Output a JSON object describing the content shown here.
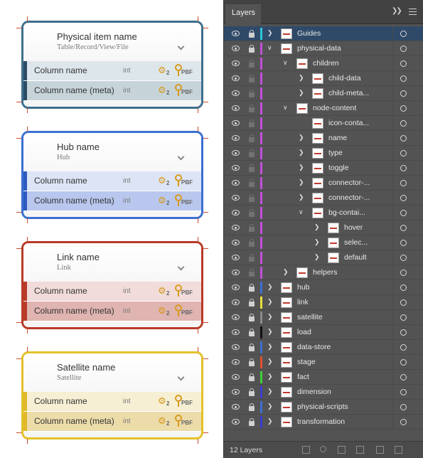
{
  "canvas": {
    "nodes": [
      {
        "title": "Physical item name",
        "subtitle": "Table/Record/View/File",
        "color": "#3f6f8c",
        "row_bar": "#2a4d66",
        "row1_bg": "#dde6ea",
        "row2_bg": "#c6d4da",
        "rows": [
          {
            "name": "Column name",
            "type": "int",
            "gear_sub": "2",
            "key_label": "PBF"
          },
          {
            "name": "Column name (meta)",
            "type": "int",
            "gear_sub": "2",
            "key_label": "PBF"
          }
        ]
      },
      {
        "title": "Hub name",
        "subtitle": "Hub",
        "color": "#3b6fd1",
        "row_bar": "#2f5bc0",
        "row1_bg": "#dde4f5",
        "row2_bg": "#b9c7ee",
        "rows": [
          {
            "name": "Column name",
            "type": "int",
            "gear_sub": "2",
            "key_label": "PBF"
          },
          {
            "name": "Column name (meta)",
            "type": "int",
            "gear_sub": "2",
            "key_label": "PBF"
          }
        ]
      },
      {
        "title": "Link name",
        "subtitle": "Link",
        "color": "#b83a28",
        "row_bar": "#b83a28",
        "row1_bg": "#f1dcdb",
        "row2_bg": "#dfb4b1",
        "rows": [
          {
            "name": "Column name",
            "type": "int",
            "gear_sub": "2",
            "key_label": "PBF"
          },
          {
            "name": "Column name (meta)",
            "type": "int",
            "gear_sub": "2",
            "key_label": "PBF"
          }
        ]
      },
      {
        "title": "Satellite name",
        "subtitle": "Satellite",
        "color": "#e3c12a",
        "row_bar": "#e0b829",
        "row1_bg": "#f6efd4",
        "row2_bg": "#ecdcaa",
        "rows": [
          {
            "name": "Column name",
            "type": "int",
            "gear_sub": "2",
            "key_label": "PBF"
          },
          {
            "name": "Column name (meta)",
            "type": "int",
            "gear_sub": "2",
            "key_label": "PBF"
          }
        ]
      }
    ]
  },
  "panel": {
    "tab_label": "Layers",
    "status_count": "12 Layers",
    "layers": [
      {
        "name": "Guides",
        "depth": 0,
        "twirl": "closed",
        "color": "#2ec4d6",
        "locked": true,
        "selected": true,
        "thumb": true
      },
      {
        "name": "physical-data",
        "depth": 0,
        "twirl": "open",
        "color": "#c14fd9",
        "locked": true,
        "selected": false,
        "thumb": true
      },
      {
        "name": "children",
        "depth": 1,
        "twirl": "open",
        "color": "#c14fd9",
        "locked": false,
        "selected": false,
        "thumb": true
      },
      {
        "name": "child-data",
        "depth": 2,
        "twirl": "closed",
        "color": "#c14fd9",
        "locked": false,
        "selected": false,
        "thumb": true
      },
      {
        "name": "child-meta...",
        "depth": 2,
        "twirl": "closed",
        "color": "#c14fd9",
        "locked": false,
        "selected": false,
        "thumb": true
      },
      {
        "name": "node-content",
        "depth": 1,
        "twirl": "open",
        "color": "#c14fd9",
        "locked": false,
        "selected": false,
        "thumb": true
      },
      {
        "name": "icon-conta...",
        "depth": 2,
        "twirl": "none",
        "color": "#c14fd9",
        "locked": false,
        "selected": false,
        "thumb": true
      },
      {
        "name": "name",
        "depth": 2,
        "twirl": "closed",
        "color": "#c14fd9",
        "locked": false,
        "selected": false,
        "thumb": true
      },
      {
        "name": "type",
        "depth": 2,
        "twirl": "closed",
        "color": "#c14fd9",
        "locked": false,
        "selected": false,
        "thumb": true
      },
      {
        "name": "toggle",
        "depth": 2,
        "twirl": "closed",
        "color": "#c14fd9",
        "locked": false,
        "selected": false,
        "thumb": true
      },
      {
        "name": "connector-...",
        "depth": 2,
        "twirl": "closed",
        "color": "#c14fd9",
        "locked": false,
        "selected": false,
        "thumb": true
      },
      {
        "name": "connector-...",
        "depth": 2,
        "twirl": "closed",
        "color": "#c14fd9",
        "locked": false,
        "selected": false,
        "thumb": true
      },
      {
        "name": "bg-contai...",
        "depth": 2,
        "twirl": "open",
        "color": "#c14fd9",
        "locked": false,
        "selected": false,
        "thumb": true
      },
      {
        "name": "hover",
        "depth": 3,
        "twirl": "closed",
        "color": "#c14fd9",
        "locked": false,
        "selected": false,
        "thumb": true
      },
      {
        "name": "selec...",
        "depth": 3,
        "twirl": "closed",
        "color": "#c14fd9",
        "locked": false,
        "selected": false,
        "thumb": true
      },
      {
        "name": "default",
        "depth": 3,
        "twirl": "closed",
        "color": "#c14fd9",
        "locked": false,
        "selected": false,
        "thumb": true
      },
      {
        "name": "helpers",
        "depth": 1,
        "twirl": "closed",
        "color": "#c14fd9",
        "locked": false,
        "selected": false,
        "thumb": true
      },
      {
        "name": "hub",
        "depth": 0,
        "twirl": "closed",
        "color": "#3b6fd1",
        "locked": true,
        "selected": false,
        "thumb": true
      },
      {
        "name": "link",
        "depth": 0,
        "twirl": "closed",
        "color": "#e8e03a",
        "locked": true,
        "selected": false,
        "thumb": true
      },
      {
        "name": "satellite",
        "depth": 0,
        "twirl": "closed",
        "color": "#8a8a8a",
        "locked": true,
        "selected": false,
        "thumb": true
      },
      {
        "name": "load",
        "depth": 0,
        "twirl": "closed",
        "color": "#111111",
        "locked": true,
        "selected": false,
        "thumb": true
      },
      {
        "name": "data-store",
        "depth": 0,
        "twirl": "closed",
        "color": "#3b6fd1",
        "locked": true,
        "selected": false,
        "thumb": true
      },
      {
        "name": "stage",
        "depth": 0,
        "twirl": "closed",
        "color": "#e0502f",
        "locked": true,
        "selected": false,
        "thumb": true
      },
      {
        "name": "fact",
        "depth": 0,
        "twirl": "closed",
        "color": "#3ad13a",
        "locked": true,
        "selected": false,
        "thumb": true
      },
      {
        "name": "dimension",
        "depth": 0,
        "twirl": "closed",
        "color": "#3b3bd1",
        "locked": true,
        "selected": false,
        "thumb": true
      },
      {
        "name": "physical-scripts",
        "depth": 0,
        "twirl": "closed",
        "color": "#3b6fd1",
        "locked": true,
        "selected": false,
        "thumb": true
      },
      {
        "name": "transformation",
        "depth": 0,
        "twirl": "closed",
        "color": "#3b3bd1",
        "locked": true,
        "selected": false,
        "thumb": true
      }
    ]
  }
}
